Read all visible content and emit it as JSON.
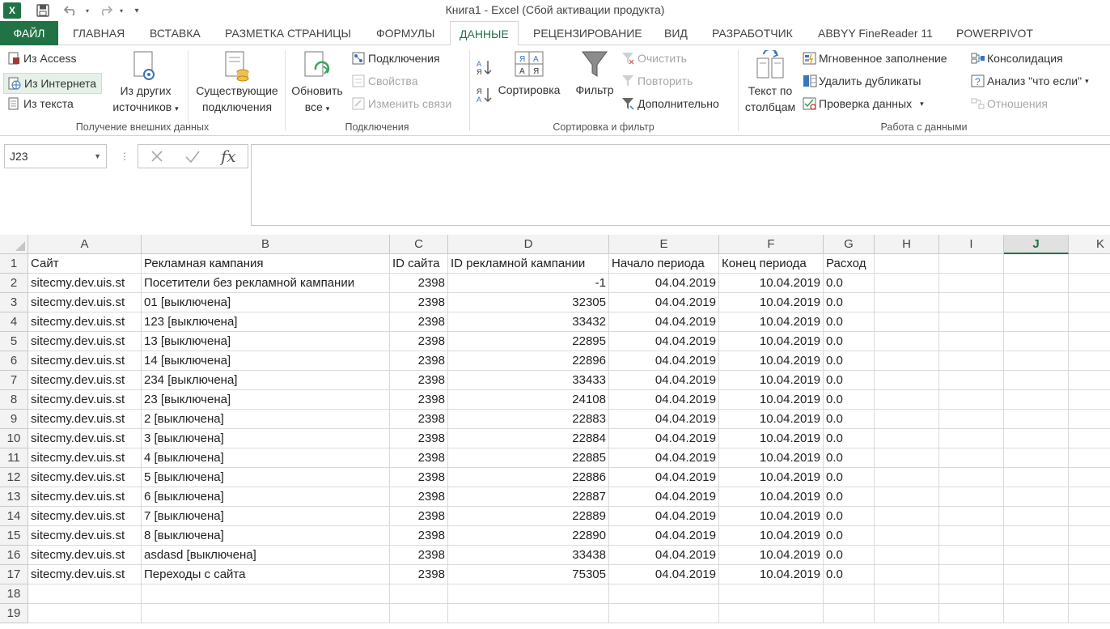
{
  "titlebar": {
    "doc_title": "Книга1 - Excel (Сбой активации продукта)",
    "app_icon": "X"
  },
  "tabs": [
    "ФАЙЛ",
    "ГЛАВНАЯ",
    "ВСТАВКА",
    "РАЗМЕТКА СТРАНИЦЫ",
    "ФОРМУЛЫ",
    "ДАННЫЕ",
    "РЕЦЕНЗИРОВАНИЕ",
    "ВИД",
    "РАЗРАБОТЧИК",
    "ABBYY FineReader 11",
    "POWERPIVOT"
  ],
  "ribbon": {
    "external": {
      "from_access": "Из Access",
      "from_web": "Из Интернета",
      "from_text": "Из текста",
      "from_other_1": "Из других",
      "from_other_2": "источников",
      "existing_1": "Существующие",
      "existing_2": "подключения",
      "group": "Получение внешних данных"
    },
    "connections": {
      "refresh_1": "Обновить",
      "refresh_2": "все",
      "connections": "Подключения",
      "properties": "Свойства",
      "edit_links": "Изменить связи",
      "group": "Подключения"
    },
    "sort": {
      "sort": "Сортировка",
      "filter": "Фильтр",
      "clear": "Очистить",
      "reapply": "Повторить",
      "advanced": "Дополнительно",
      "group": "Сортировка и фильтр"
    },
    "tools": {
      "text_to_cols_1": "Текст по",
      "text_to_cols_2": "столбцам",
      "flash_fill": "Мгновенное заполнение",
      "remove_dupes": "Удалить дубликаты",
      "validation": "Проверка данных",
      "consolidate": "Консолидация",
      "whatif": "Анализ \"что если\"",
      "relationships": "Отношения",
      "group": "Работа с данными"
    }
  },
  "namebox": "J23",
  "formula": "",
  "columns": [
    "A",
    "B",
    "C",
    "D",
    "E",
    "F",
    "G",
    "H",
    "I",
    "J",
    "K"
  ],
  "rows": [
    [
      "Сайт",
      "Рекламная кампания",
      "ID сайта",
      "ID рекламной кампании",
      "Начало периода",
      "Конец периода",
      "Расход"
    ],
    [
      "sitecmy.dev.uis.st",
      "Посетители без рекламной кампании",
      "2398",
      "-1",
      "04.04.2019",
      "10.04.2019",
      "0.0"
    ],
    [
      "sitecmy.dev.uis.st",
      "01 [выключена]",
      "2398",
      "32305",
      "04.04.2019",
      "10.04.2019",
      "0.0"
    ],
    [
      "sitecmy.dev.uis.st",
      "123 [выключена]",
      "2398",
      "33432",
      "04.04.2019",
      "10.04.2019",
      "0.0"
    ],
    [
      "sitecmy.dev.uis.st",
      "13 [выключена]",
      "2398",
      "22895",
      "04.04.2019",
      "10.04.2019",
      "0.0"
    ],
    [
      "sitecmy.dev.uis.st",
      "14 [выключена]",
      "2398",
      "22896",
      "04.04.2019",
      "10.04.2019",
      "0.0"
    ],
    [
      "sitecmy.dev.uis.st",
      "234 [выключена]",
      "2398",
      "33433",
      "04.04.2019",
      "10.04.2019",
      "0.0"
    ],
    [
      "sitecmy.dev.uis.st",
      "23 [выключена]",
      "2398",
      "24108",
      "04.04.2019",
      "10.04.2019",
      "0.0"
    ],
    [
      "sitecmy.dev.uis.st",
      "2 [выключена]",
      "2398",
      "22883",
      "04.04.2019",
      "10.04.2019",
      "0.0"
    ],
    [
      "sitecmy.dev.uis.st",
      "3 [выключена]",
      "2398",
      "22884",
      "04.04.2019",
      "10.04.2019",
      "0.0"
    ],
    [
      "sitecmy.dev.uis.st",
      "4 [выключена]",
      "2398",
      "22885",
      "04.04.2019",
      "10.04.2019",
      "0.0"
    ],
    [
      "sitecmy.dev.uis.st",
      "5 [выключена]",
      "2398",
      "22886",
      "04.04.2019",
      "10.04.2019",
      "0.0"
    ],
    [
      "sitecmy.dev.uis.st",
      "6 [выключена]",
      "2398",
      "22887",
      "04.04.2019",
      "10.04.2019",
      "0.0"
    ],
    [
      "sitecmy.dev.uis.st",
      "7 [выключена]",
      "2398",
      "22889",
      "04.04.2019",
      "10.04.2019",
      "0.0"
    ],
    [
      "sitecmy.dev.uis.st",
      "8 [выключена]",
      "2398",
      "22890",
      "04.04.2019",
      "10.04.2019",
      "0.0"
    ],
    [
      "sitecmy.dev.uis.st",
      "asdasd [выключена]",
      "2398",
      "33438",
      "04.04.2019",
      "10.04.2019",
      "0.0"
    ],
    [
      "sitecmy.dev.uis.st",
      "Переходы с сайта",
      "2398",
      "75305",
      "04.04.2019",
      "10.04.2019",
      "0.0"
    ],
    [],
    []
  ],
  "colors": {
    "accent": "#217346",
    "selected_header_bg": "#e1e1e1",
    "gridline": "#dadada"
  }
}
